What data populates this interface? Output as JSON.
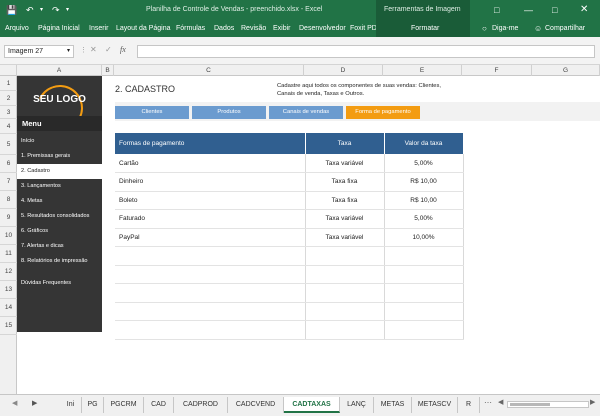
{
  "window": {
    "title": "Planilha de Controle de Vendas - preenchido.xlsx - Excel",
    "context_tab": "Ferramentas de Imagem"
  },
  "ribbon": {
    "tabs": [
      "Arquivo",
      "Página Inicial",
      "Inserir",
      "Layout da Página",
      "Fórmulas",
      "Dados",
      "Revisão",
      "Exibir",
      "Desenvolvedor",
      "Foxit PDF"
    ],
    "format_tab": "Formatar",
    "tell_me": "Diga-me",
    "share": "Compartilhar"
  },
  "formula_bar": {
    "name_box": "Imagem 27",
    "fx": "fx",
    "value": ""
  },
  "columns": [
    "A",
    "B",
    "C",
    "D",
    "E",
    "F",
    "G"
  ],
  "rows": [
    "1",
    "2",
    "3",
    "4",
    "5",
    "6",
    "7",
    "8",
    "9",
    "10",
    "11",
    "12",
    "13",
    "14",
    "15"
  ],
  "sheet": {
    "logo": "SEU LOGO",
    "menu_title": "Menu",
    "menu_items": [
      "Início",
      "1. Premissas gerais",
      "2. Cadastro",
      "3. Lançamentos",
      "4. Metas",
      "5. Resultados consolidados",
      "6. Gráficos",
      "7. Alertas e dicas",
      "8. Relatórios de impressão",
      "Dúvidas Frequentes"
    ],
    "heading": "2. CADASTRO",
    "description": "Cadastre aqui todos os componentes de suas vendas: Clientes, Canais de venda, Taxas e Outros.",
    "nav_buttons": [
      "Clientes",
      "Produtos",
      "Canais de vendas",
      "Forma de pagamento"
    ],
    "table": {
      "headers": [
        "Formas de pagamento",
        "Taxa",
        "Valor da taxa"
      ],
      "rows": [
        [
          "Cartão",
          "Taxa variável",
          "5,00%"
        ],
        [
          "Dinheiro",
          "Taxa fixa",
          "R$ 10,00"
        ],
        [
          "Boleto",
          "Taxa fixa",
          "R$ 10,00"
        ],
        [
          "Faturado",
          "Taxa variável",
          "5,00%"
        ],
        [
          "PayPal",
          "Taxa variável",
          "10,00%"
        ]
      ]
    }
  },
  "sheet_tabs": [
    "Ini",
    "PG",
    "PGCRM",
    "CAD",
    "CADPROD",
    "CADCVEND",
    "CADTAXAS",
    "LANÇ",
    "METAS",
    "METASCV",
    "R"
  ],
  "active_tab": "CADTAXAS",
  "colors": {
    "excel_green": "#217346",
    "menu_dark": "#353535",
    "table_header": "#305f90",
    "nav_blue": "#6b9bcf",
    "nav_orange": "#f39c12"
  }
}
